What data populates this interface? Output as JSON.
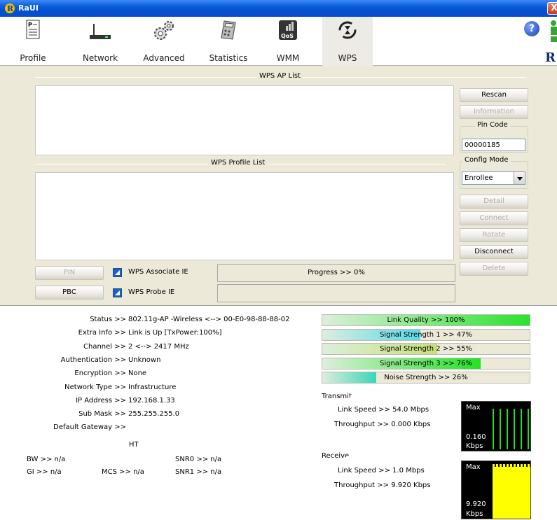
{
  "window": {
    "title": "RaUI",
    "close": "X"
  },
  "toolbar": {
    "items": [
      {
        "label": "Profile"
      },
      {
        "label": "Network"
      },
      {
        "label": "Advanced"
      },
      {
        "label": "Statistics"
      },
      {
        "label": "WMM"
      },
      {
        "label": "WPS"
      }
    ],
    "help": "?",
    "logo": "R",
    "qos_badge": "QoS"
  },
  "wps": {
    "ap_list_title": "WPS AP List",
    "profile_list_title": "WPS Profile List",
    "buttons": {
      "rescan": "Rescan",
      "information": "Information",
      "detail": "Detail",
      "connect": "Connect",
      "rotate": "Rotate",
      "disconnect": "Disconnect",
      "delete": "Delete",
      "pin": "PIN",
      "pbc": "PBC"
    },
    "pin_code_title": "Pin Code",
    "pin_code_value": "00000185",
    "config_mode_title": "Config Mode",
    "config_mode_value": "Enrollee",
    "associate_ie": "WPS Associate IE",
    "probe_ie": "WPS Probe IE",
    "progress": "Progress >> 0%"
  },
  "status": {
    "rows": [
      {
        "key": "Status >>",
        "value": "802.11g-AP -Wireless  <--> 00-E0-98-88-88-02"
      },
      {
        "key": "Extra Info >>",
        "value": "Link is Up [TxPower:100%]"
      },
      {
        "key": "Channel >>",
        "value": "2 <--> 2417 MHz"
      },
      {
        "key": "Authentication >>",
        "value": "Unknown"
      },
      {
        "key": "Encryption >>",
        "value": "None"
      },
      {
        "key": "Network Type >>",
        "value": "Infrastructure"
      },
      {
        "key": "IP Address >>",
        "value": "192.168.1.33"
      },
      {
        "key": "Sub Mask >>",
        "value": "255.255.255.0"
      },
      {
        "key": "Default Gateway >>",
        "value": ""
      }
    ],
    "ht_title": "HT",
    "ht": {
      "bw": "BW >> n/a",
      "gi": "GI >> n/a",
      "mcs": "MCS >> n/a",
      "snr0": "SNR0 >> n/a",
      "snr1": "SNR1 >> n/a"
    }
  },
  "signal": {
    "bars": [
      {
        "label": "Link Quality >> 100%",
        "percent": 100,
        "color": "#27e32b"
      },
      {
        "label": "Signal Strength 1 >> 47%",
        "percent": 47,
        "color": "#58d8e8"
      },
      {
        "label": "Signal Strength 2 >> 55%",
        "percent": 55,
        "color": "#c6e078"
      },
      {
        "label": "Signal Strength 3 >> 76%",
        "percent": 76,
        "color": "#22e322"
      },
      {
        "label": "Noise Strength >> 26%",
        "percent": 26,
        "color": "#3ad6b8"
      }
    ]
  },
  "transmit": {
    "title": "Transmit",
    "link_speed": "Link Speed >> 54.0 Mbps",
    "throughput": "Throughput >> 0.000 Kbps",
    "meter_max": "Max",
    "meter_value": "0.160",
    "meter_unit": "Kbps"
  },
  "receive": {
    "title": "Receive",
    "link_speed": "Link Speed >> 1.0 Mbps",
    "throughput": "Throughput >> 9.920 Kbps",
    "meter_max": "Max",
    "meter_value": "9.920",
    "meter_unit": "Kbps"
  }
}
